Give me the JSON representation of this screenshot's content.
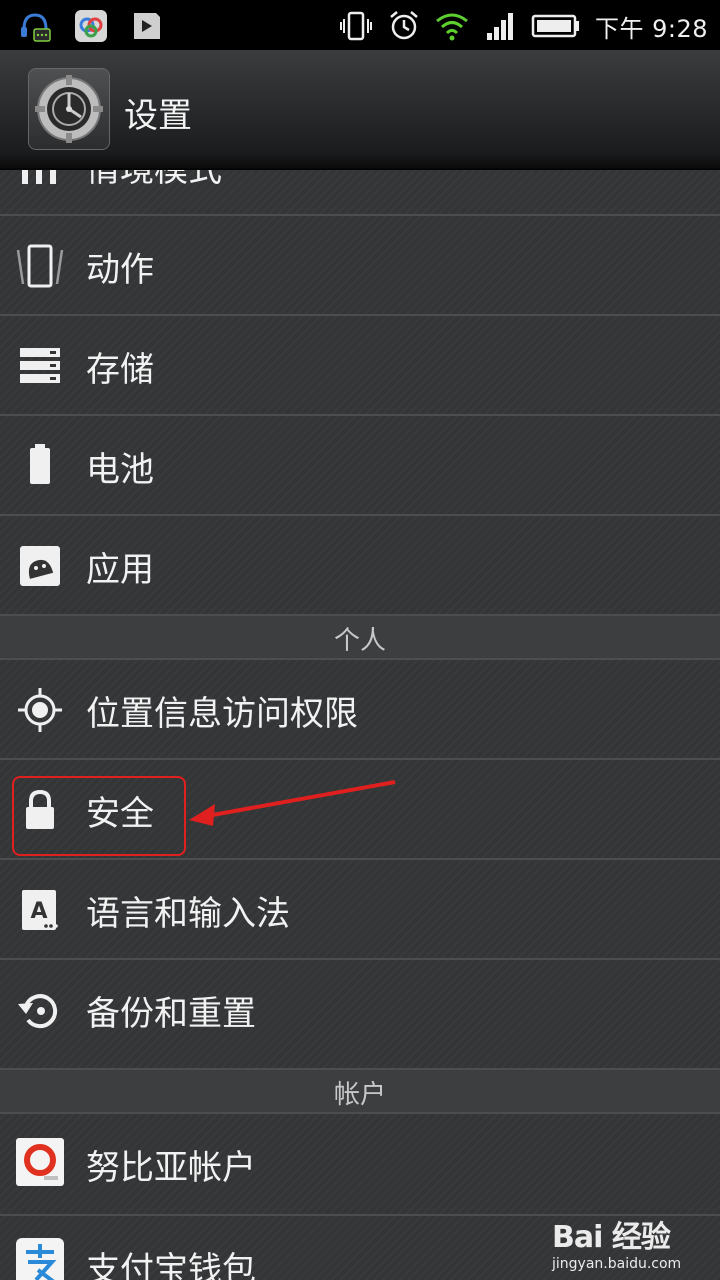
{
  "status_bar": {
    "time": "下午 9:28",
    "icons_left": [
      "headset-chat-icon",
      "baidu-app-icon",
      "media-file-icon"
    ],
    "icons_right": [
      "vibrate-icon",
      "alarm-icon",
      "wifi-icon",
      "signal-icon",
      "battery-icon"
    ]
  },
  "action_bar": {
    "title": "设置",
    "icon": "settings-gear-icon"
  },
  "list": {
    "partial_item": "情境模式",
    "items_top": [
      {
        "label": "动作",
        "icon": "phone-motion-icon"
      },
      {
        "label": "存储",
        "icon": "storage-icon"
      },
      {
        "label": "电池",
        "icon": "battery-icon"
      },
      {
        "label": "应用",
        "icon": "android-apps-icon"
      }
    ],
    "section_personal": "个人",
    "items_personal": [
      {
        "label": "位置信息访问权限",
        "icon": "location-icon"
      },
      {
        "label": "安全",
        "icon": "lock-icon"
      },
      {
        "label": "语言和输入法",
        "icon": "keyboard-language-icon"
      },
      {
        "label": "备份和重置",
        "icon": "backup-restore-icon"
      }
    ],
    "section_accounts": "帐户",
    "items_accounts": [
      {
        "label": "努比亚帐户",
        "icon": "nubia-icon"
      },
      {
        "label": "支付宝钱包",
        "icon": "alipay-icon"
      }
    ]
  },
  "watermark": {
    "logo": "Bai 经验",
    "url": "jingyan.baidu.com"
  },
  "colors": {
    "highlight": "#e0201e",
    "divider": "#4b4d4f",
    "text": "#f2f2f2"
  }
}
